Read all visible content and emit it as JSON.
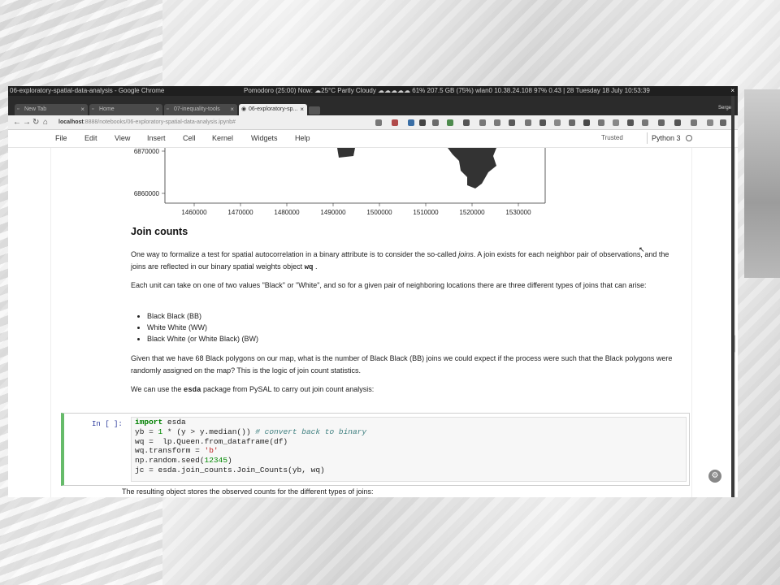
{
  "system": {
    "window_title": "06-exploratory-spatial-data-analysis - Google Chrome",
    "status": "Pomodoro (25:00)  Now: ☁25°C Partly Cloudy  ☁☁☁☁☁ 61% 207.5 GB (75%)  wlan0 10.38.24.108  97%  0.43 | 28  Tuesday 18 July  10:53:39",
    "close": "×"
  },
  "tabs": [
    {
      "label": "New Tab",
      "icon": "page-icon"
    },
    {
      "label": "Home",
      "icon": "page-icon"
    },
    {
      "label": "07-inequality-tools",
      "icon": "page-icon"
    },
    {
      "label": "06-exploratory-sp...",
      "icon": "jupyter-icon",
      "active": true
    }
  ],
  "user": "Serge",
  "address": {
    "host": "localhost",
    "path": ":8888/notebooks/06-exploratory-spatial-data-analysis.ipynb#"
  },
  "menu": {
    "items": [
      "File",
      "Edit",
      "View",
      "Insert",
      "Cell",
      "Kernel",
      "Widgets",
      "Help"
    ],
    "trusted": "Trusted",
    "kernel": "Python 3"
  },
  "chart_data": {
    "type": "map",
    "yticks": [
      "6870000",
      "6860000"
    ],
    "xticks": [
      "1460000",
      "1470000",
      "1480000",
      "1490000",
      "1500000",
      "1510000",
      "1520000",
      "1530000"
    ]
  },
  "markdown": {
    "heading": "Join counts",
    "p1_a": "One way to formalize a test for spatial autocorrelation in a binary attribute is to consider the so-called ",
    "p1_em": "joins",
    "p1_b": ". A join exists for each neighbor pair of observations, and the joins are reflected in our binary spatial weights object ",
    "p1_code": "wq",
    "p1_c": " .",
    "p2": "Each unit can take on one of two values \"Black\" or \"White\", and so for a given pair of neighboring locations there are three different types of joins that can arise:",
    "bullets": [
      "Black Black (BB)",
      "White White (WW)",
      "Black White (or White Black) (BW)"
    ],
    "p3": "Given that we have 68 Black polygons on our map, what is the number of Black Black (BB) joins we could expect if the process were such that the Black polygons were randomly assigned on the map? This is the logic of join count statistics.",
    "p4_a": "We can use the ",
    "p4_code": "esda",
    "p4_b": " package from PySAL to carry out join count analysis:",
    "p5": "The resulting object stores the observed counts for the different types of joins:"
  },
  "code_cell": {
    "prompt": "In [ ]:",
    "lines": [
      {
        "kw": "import",
        "rest": " esda"
      },
      {
        "pre": "yb = ",
        "num": "1",
        "mid": " * (y > y.median()) ",
        "cm": "# convert back to binary"
      },
      {
        "plain": "wq =  lp.Queen.from_dataframe(df)"
      },
      {
        "pre": "wq.transform = ",
        "str": "'b'"
      },
      {
        "pre": "np.random.seed(",
        "num": "12345",
        "post": ")"
      },
      {
        "plain": "jc = esda.join_counts.Join_Counts(yb, wq)"
      }
    ]
  }
}
